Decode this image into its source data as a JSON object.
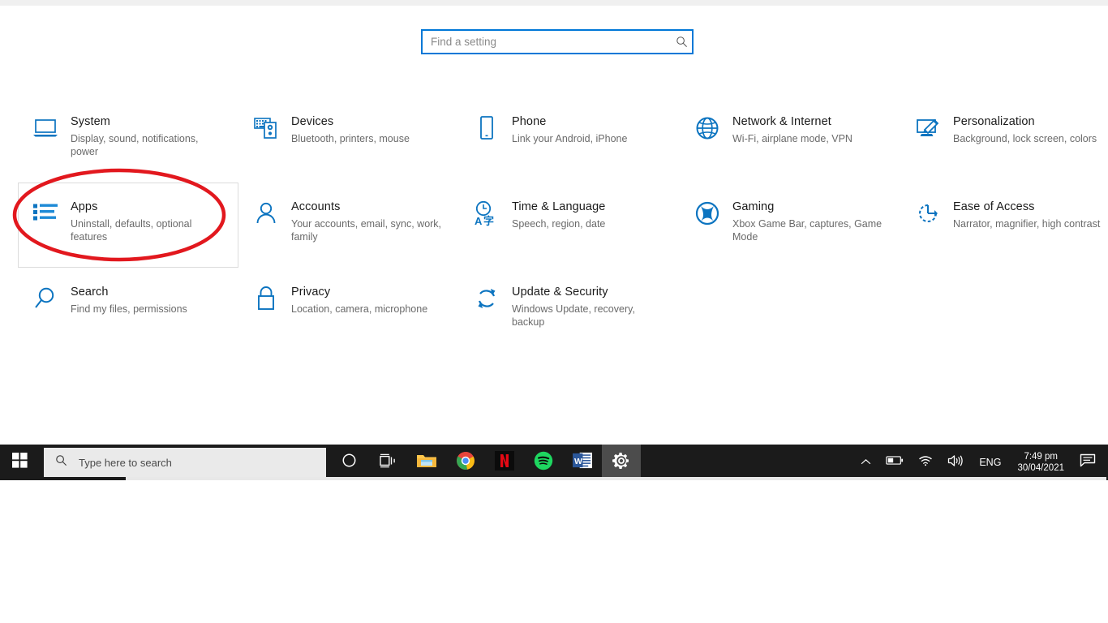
{
  "app": {
    "name": "Windows Settings"
  },
  "search": {
    "placeholder": "Find a setting",
    "value": "",
    "icon": "search-icon"
  },
  "annotation": {
    "shape": "ellipse",
    "color": "#e2181e",
    "target": "Apps",
    "stroke_width": 4
  },
  "tiles": [
    {
      "title": "System",
      "subtitle": "Display, sound, notifications, power",
      "icon": "laptop-icon",
      "focused": false
    },
    {
      "title": "Devices",
      "subtitle": "Bluetooth, printers, mouse",
      "icon": "keyboard-mouse-icon",
      "focused": false
    },
    {
      "title": "Phone",
      "subtitle": "Link your Android, iPhone",
      "icon": "phone-icon",
      "focused": false
    },
    {
      "title": "Network & Internet",
      "subtitle": "Wi-Fi, airplane mode, VPN",
      "icon": "globe-icon",
      "focused": false
    },
    {
      "title": "Personalization",
      "subtitle": "Background, lock screen, colors",
      "icon": "paintbrush-icon",
      "focused": false
    },
    {
      "title": "Apps",
      "subtitle": "Uninstall, defaults, optional features",
      "icon": "app-list-icon",
      "focused": true
    },
    {
      "title": "Accounts",
      "subtitle": "Your accounts, email, sync, work, family",
      "icon": "person-icon",
      "focused": false
    },
    {
      "title": "Time & Language",
      "subtitle": "Speech, region, date",
      "icon": "clock-language-icon",
      "focused": false
    },
    {
      "title": "Gaming",
      "subtitle": "Xbox Game Bar, captures, Game Mode",
      "icon": "xbox-icon",
      "focused": false
    },
    {
      "title": "Ease of Access",
      "subtitle": "Narrator, magnifier, high contrast",
      "icon": "ease-of-access-icon",
      "focused": false
    },
    {
      "title": "Search",
      "subtitle": "Find my files, permissions",
      "icon": "magnifier-icon",
      "focused": false
    },
    {
      "title": "Privacy",
      "subtitle": "Location, camera, microphone",
      "icon": "lock-icon",
      "focused": false
    },
    {
      "title": "Update & Security",
      "subtitle": "Windows Update, recovery, backup",
      "icon": "refresh-icon",
      "focused": false
    }
  ],
  "taskbar": {
    "start_icon": "windows-logo-icon",
    "search": {
      "placeholder": "Type here to search",
      "icon": "search-icon"
    },
    "apps": [
      {
        "name": "cortana",
        "icon": "cortana-circle-icon",
        "running": false,
        "active": false
      },
      {
        "name": "task-view",
        "icon": "task-view-icon",
        "running": false,
        "active": false
      },
      {
        "name": "file-explorer",
        "icon": "folder-icon",
        "running": true,
        "active": false
      },
      {
        "name": "chrome",
        "icon": "chrome-icon",
        "running": true,
        "active": false
      },
      {
        "name": "netflix",
        "icon": "netflix-icon",
        "running": false,
        "active": false
      },
      {
        "name": "spotify",
        "icon": "spotify-icon",
        "running": false,
        "active": false
      },
      {
        "name": "word",
        "icon": "word-icon",
        "running": true,
        "active": false
      },
      {
        "name": "settings",
        "icon": "gear-icon",
        "running": true,
        "active": true
      }
    ],
    "tray": {
      "overflow_icon": "chevron-up-icon",
      "battery_icon": "battery-icon",
      "wifi_icon": "wifi-icon",
      "volume_icon": "volume-icon",
      "language": "ENG",
      "time": "7:49 pm",
      "date": "30/04/2021",
      "action_center_icon": "notification-icon"
    }
  },
  "colors": {
    "accent": "#0078d7",
    "icon_blue": "#0c74c0",
    "annotation_red": "#e2181e",
    "taskbar_bg": "#1b1b1b"
  }
}
